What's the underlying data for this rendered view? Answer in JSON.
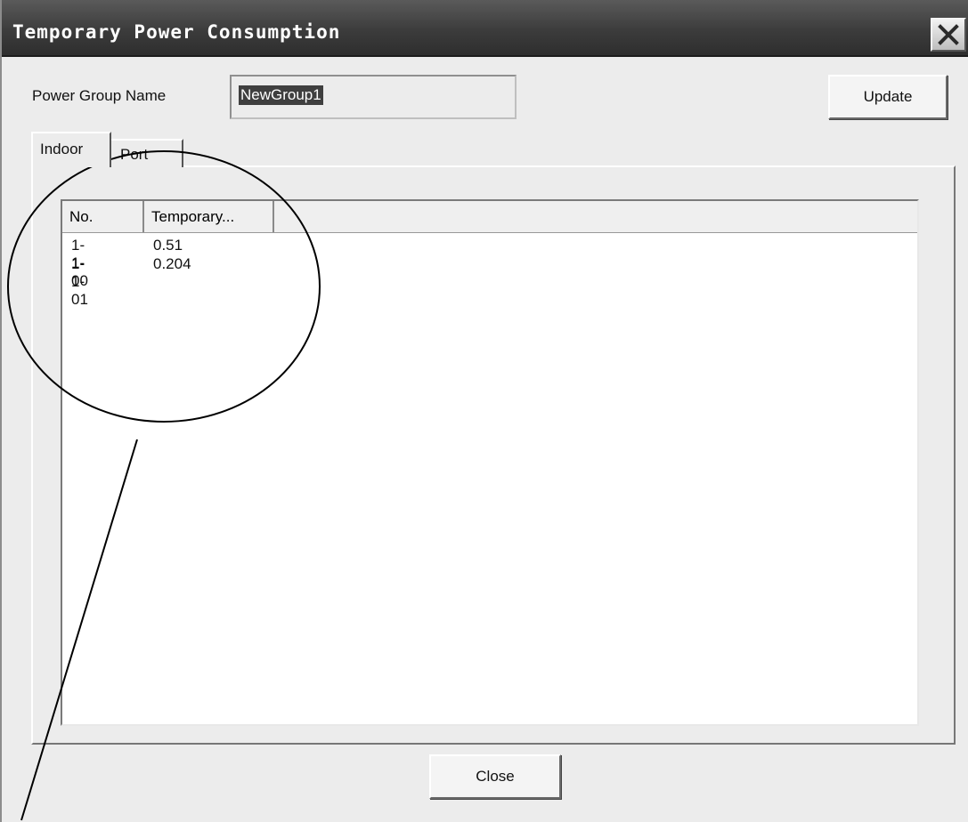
{
  "window": {
    "title": "Temporary Power Consumption",
    "close_icon": "close-icon"
  },
  "form": {
    "group_name_label": "Power Group Name",
    "group_name_value": "NewGroup1",
    "update_label": "Update"
  },
  "tabs": [
    {
      "label": "Indoor",
      "active": true
    },
    {
      "label": "Port",
      "active": false
    }
  ],
  "list": {
    "columns": [
      "No.",
      "Temporary..."
    ],
    "rows": [
      {
        "no": "1-1-00",
        "value": "0.51"
      },
      {
        "no": "1-1-01",
        "value": "0.204"
      }
    ]
  },
  "footer": {
    "close_label": "Close"
  }
}
